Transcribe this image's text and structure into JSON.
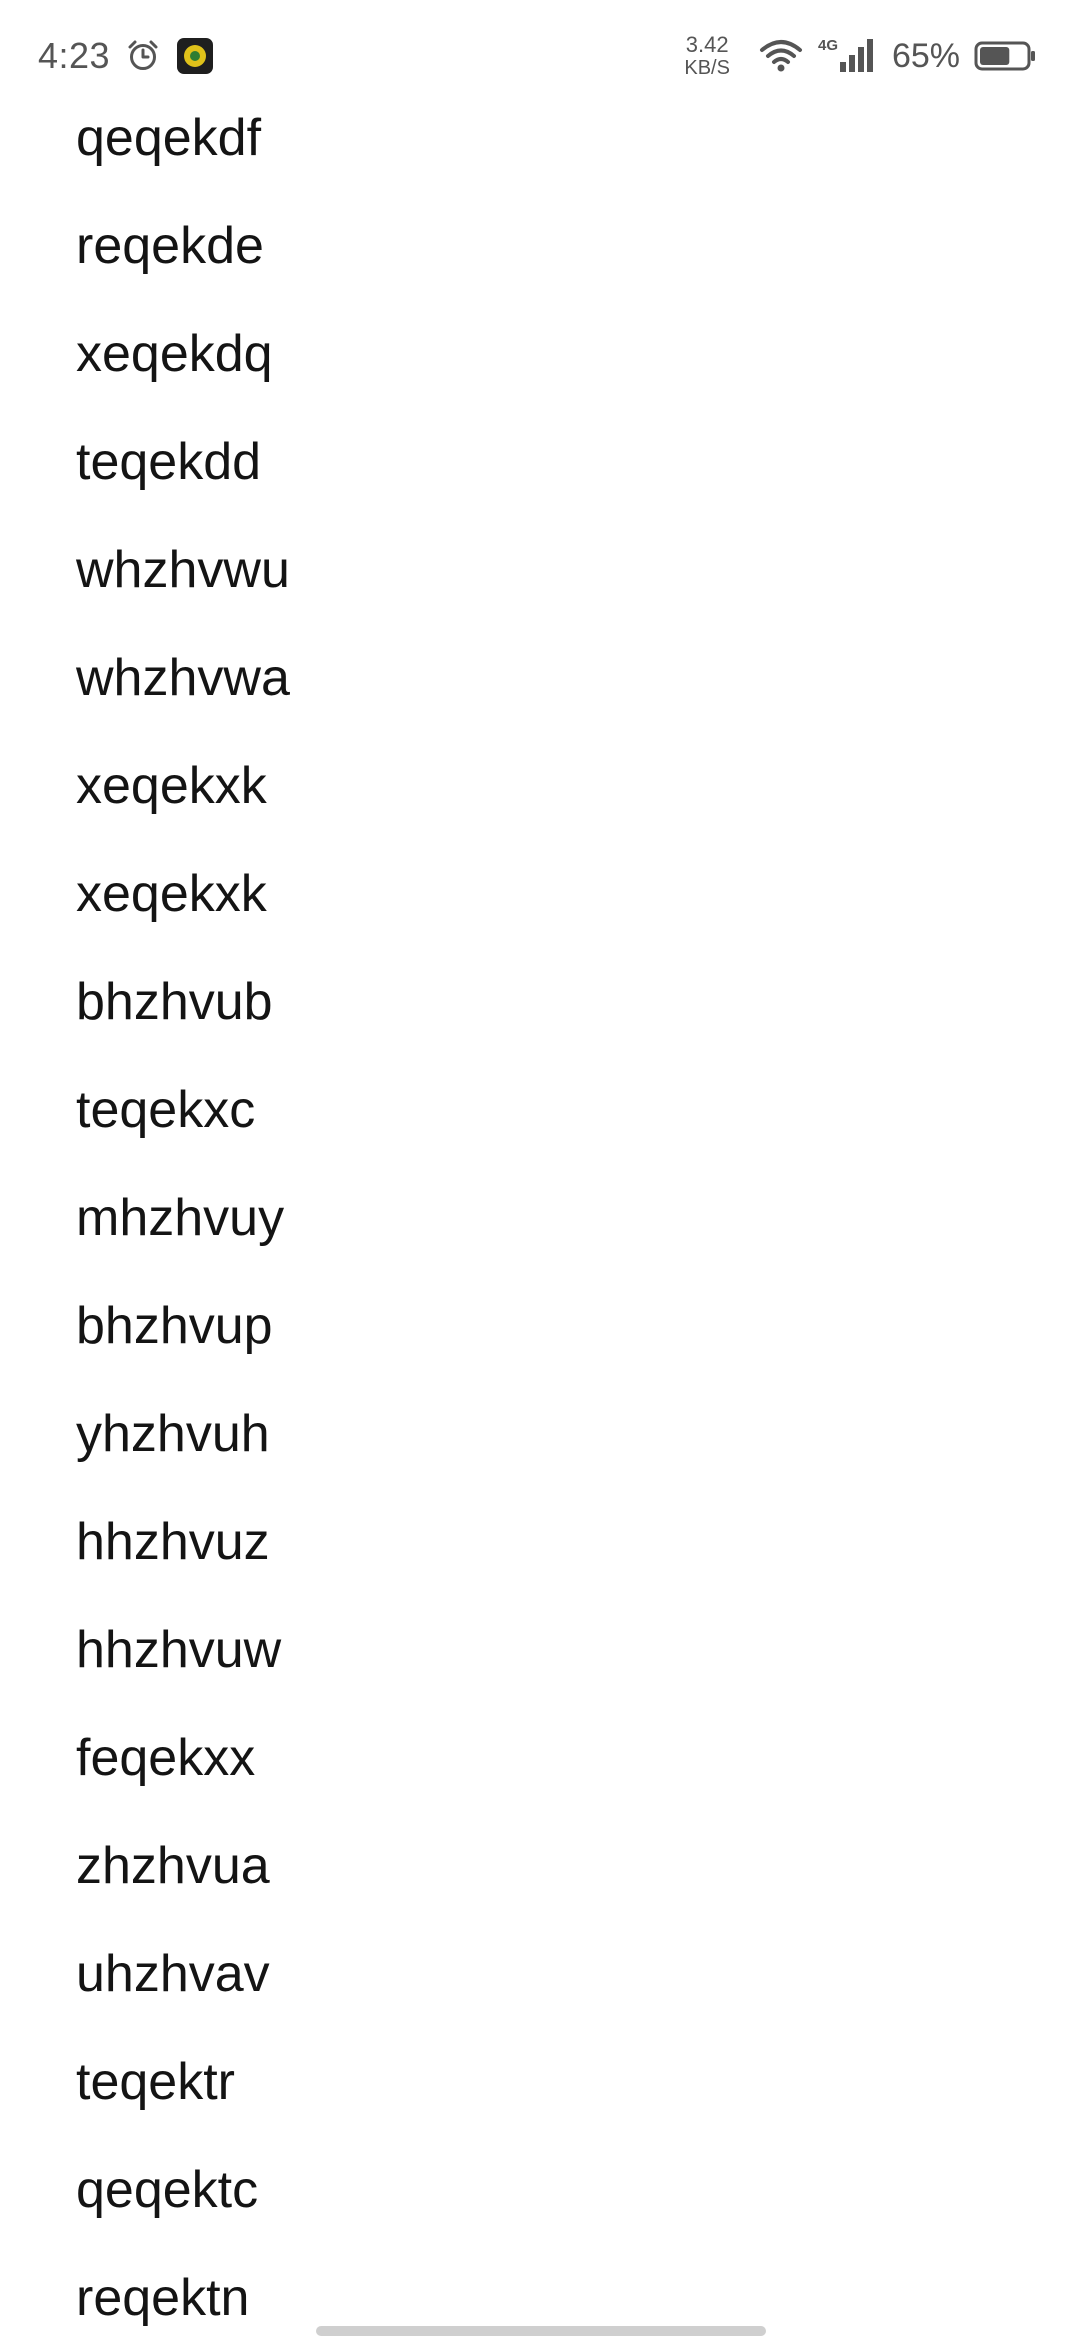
{
  "status_bar": {
    "time": "4:23",
    "alarm_icon": "alarm-clock-icon",
    "app_icon": "app-notification-icon",
    "network_speed_value": "3.42",
    "network_speed_unit": "KB/S",
    "wifi_icon": "wifi-icon",
    "network_type": "4G",
    "signal_icon": "cellular-signal-icon",
    "battery_percent": "65%",
    "battery_level": 0.65,
    "battery_icon": "battery-icon"
  },
  "list": {
    "items": [
      "qeqekdf",
      "reqekde",
      "xeqekdq",
      "teqekdd",
      "whzhvwu",
      "whzhvwa",
      "xeqekxk",
      "xeqekxk",
      "bhzhvub",
      "teqekxc",
      "mhzhvuy",
      "bhzhvup",
      "yhzhvuh",
      "hhzhvuz",
      "hhzhvuw",
      "feqekxx",
      "zhzhvua",
      "uhzhvav",
      "teqektr",
      "qeqektc",
      "reqektn"
    ]
  },
  "colors": {
    "background": "#ffffff",
    "text": "#141414",
    "status_text": "#555555",
    "gesture_bar": "#cfcfcf",
    "app_icon_bg": "#1f1f1f",
    "app_icon_fg": "#e0c21a"
  }
}
